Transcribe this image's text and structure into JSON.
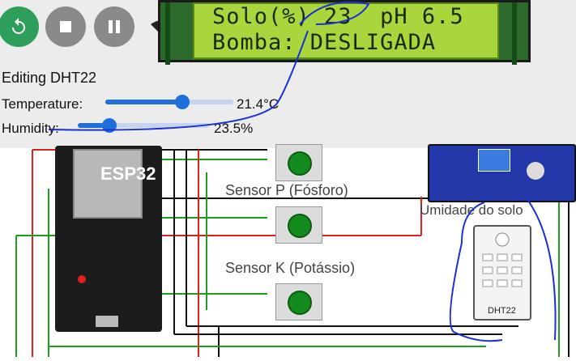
{
  "controls": {
    "restart_icon": "restart-icon",
    "stop_icon": "stop-icon",
    "pause_icon": "pause-icon",
    "restart_color": "#2e9f5a",
    "button_color": "#8a8a8a"
  },
  "lcd": {
    "line1": "Solo(%) 23  pH 6.5",
    "line2": "Bomba: DESLIGADA"
  },
  "editor": {
    "title": "Editing DHT22",
    "temperature_label": "Temperature:",
    "temperature_value": "21.4°C",
    "temperature_level": 0.6,
    "humidity_label": "Humidity:",
    "humidity_value": "23.5%",
    "humidity_level": 0.24
  },
  "circuit": {
    "esp_label": "ESP32",
    "sensor_p": "Sensor P (Fósforo)",
    "sensor_k": "Sensor K (Potássio)",
    "soil_label": "Umidade do solo",
    "dht_label": "DHT22"
  }
}
